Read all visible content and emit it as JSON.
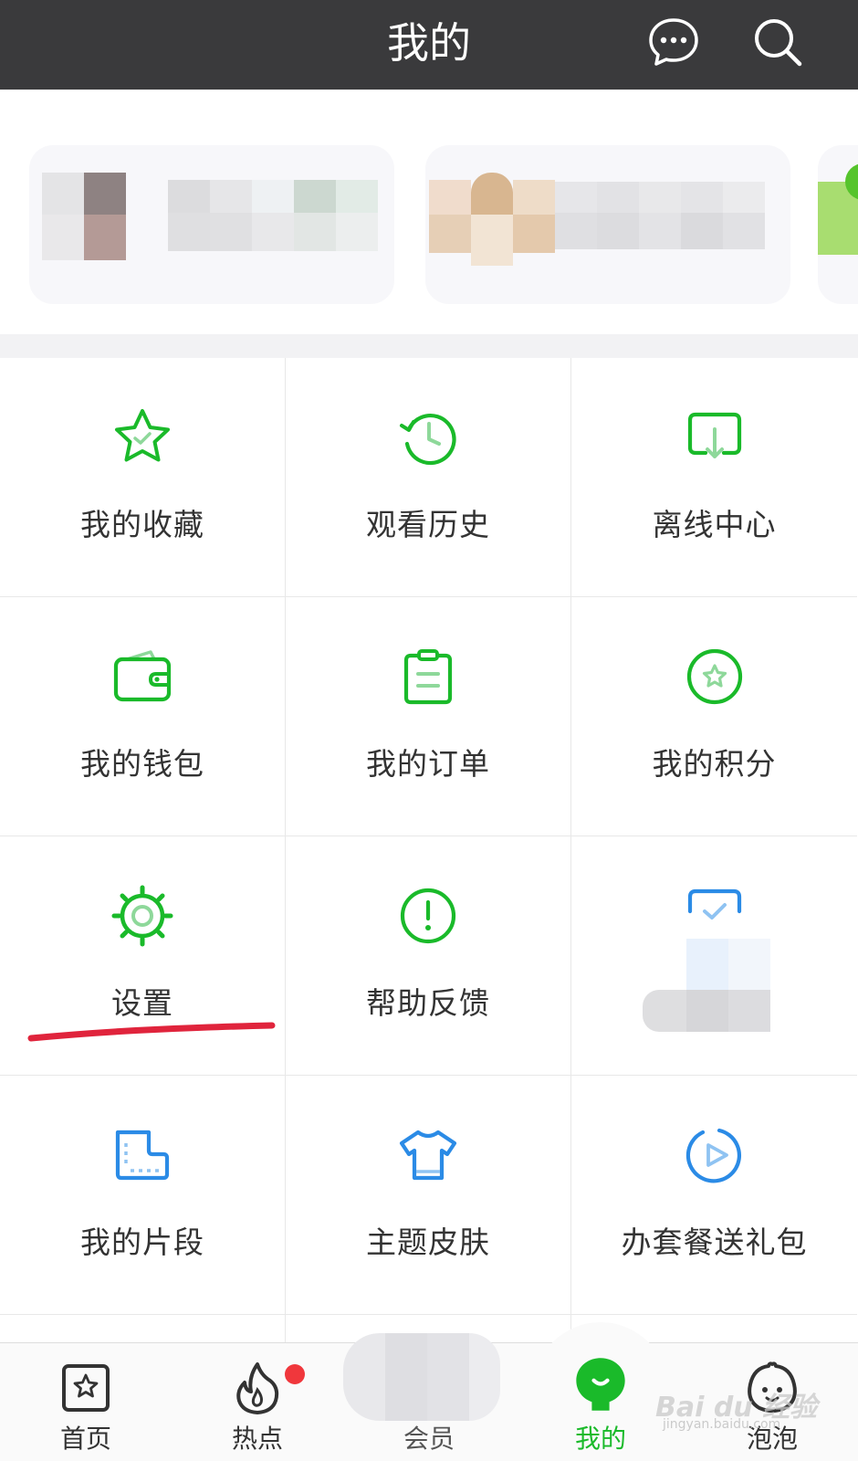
{
  "header": {
    "title": "我的",
    "message_icon": "chat-bubble-icon",
    "search_icon": "search-icon"
  },
  "grid": {
    "items": [
      {
        "label": "我的收藏",
        "icon": "star-check-icon"
      },
      {
        "label": "观看历史",
        "icon": "clock-history-icon"
      },
      {
        "label": "离线中心",
        "icon": "download-icon"
      },
      {
        "label": "我的钱包",
        "icon": "wallet-icon"
      },
      {
        "label": "我的订单",
        "icon": "clipboard-icon"
      },
      {
        "label": "我的积分",
        "icon": "points-star-icon"
      },
      {
        "label": "设置",
        "icon": "gear-icon"
      },
      {
        "label": "帮助反馈",
        "icon": "exclamation-icon"
      },
      {
        "label": "",
        "icon": "checkbox-icon"
      },
      {
        "label": "我的片段",
        "icon": "film-clip-icon"
      },
      {
        "label": "主题皮肤",
        "icon": "tshirt-icon"
      },
      {
        "label": "办套餐送礼包",
        "icon": "play-circle-icon"
      }
    ]
  },
  "tabbar": {
    "tabs": [
      {
        "label": "首页",
        "icon": "home-star-icon"
      },
      {
        "label": "热点",
        "icon": "flame-icon"
      },
      {
        "label": "会员",
        "icon": "vip-icon"
      },
      {
        "label": "我的",
        "icon": "mine-face-icon",
        "active": true
      },
      {
        "label": "泡泡",
        "icon": "bubble-face-icon"
      }
    ]
  },
  "watermark": {
    "text": "Bai du 经验",
    "sub": "jingyan.baidu.com"
  },
  "colors": {
    "header_bg": "#3a3a3c",
    "accent_green": "#1aba2a",
    "icon_blue": "#2b8be6",
    "annotation_red": "#e0243c",
    "badge_red": "#f0373c"
  }
}
